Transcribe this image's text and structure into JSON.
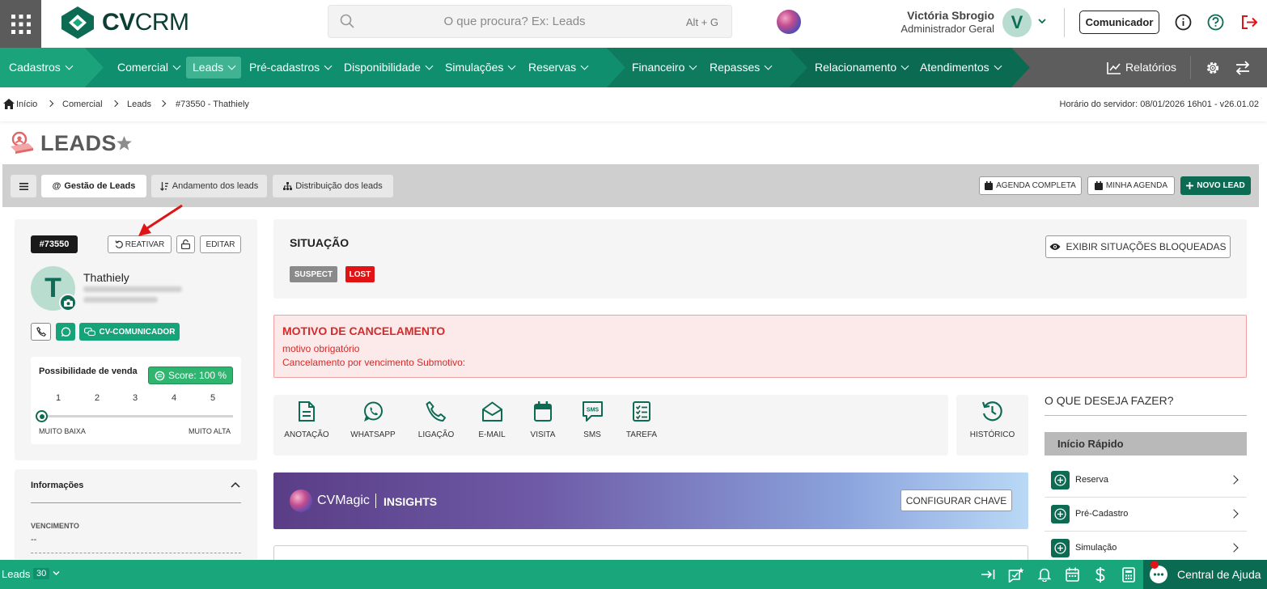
{
  "app": {
    "logo_bold": "CV",
    "logo_light": "CRM"
  },
  "search": {
    "placeholder": "O que procura? Ex: Leads",
    "shortcut": "Alt + G"
  },
  "user": {
    "name": "Victória Sbrogio",
    "role": "Administrador Geral",
    "initial": "V"
  },
  "header": {
    "communicator_label": "Comunicador"
  },
  "nav": {
    "items": [
      {
        "label": "Cadastros"
      },
      {
        "label": "Comercial"
      },
      {
        "label": "Leads"
      },
      {
        "label": "Pré-cadastros"
      },
      {
        "label": "Disponibilidade"
      },
      {
        "label": "Simulações"
      },
      {
        "label": "Reservas"
      },
      {
        "label": "Financeiro"
      },
      {
        "label": "Repasses"
      },
      {
        "label": "Relacionamento"
      },
      {
        "label": "Atendimentos"
      }
    ],
    "reports_label": "Relatórios",
    "colors": {
      "seg1": "#17a57c",
      "seg2": "#0f8f6d",
      "seg3": "#0e7a5e",
      "seg4": "#0b6a52",
      "gray": "#5d5d5d"
    }
  },
  "breadcrumb": {
    "items": [
      "Início",
      "Comercial",
      "Leads",
      "#73550 - Thathiely"
    ],
    "server_time": "Horário do servidor: 08/01/2026 16h01 - v26.01.02"
  },
  "page": {
    "title": "LEADS"
  },
  "tabs": [
    {
      "label": "Gestão de Leads"
    },
    {
      "label": "Andamento dos leads"
    },
    {
      "label": "Distribuição dos leads"
    }
  ],
  "toolbar_right": {
    "agenda_completa": "AGENDA COMPLETA",
    "minha_agenda": "MINHA AGENDA",
    "novo_lead": "NOVO LEAD"
  },
  "lead": {
    "id": "#73550",
    "reactivate_label": "REATIVAR",
    "edit_label": "EDITAR",
    "initial": "T",
    "name": "Thathiely",
    "communicator_label": "CV-COMUNICADOR"
  },
  "score": {
    "title": "Possibilidade de venda",
    "badge": "Score: 100 %",
    "scale": [
      "1",
      "2",
      "3",
      "4",
      "5"
    ],
    "low_label": "MUITO BAIXA",
    "high_label": "MUITO ALTA",
    "selected_level": 0
  },
  "info": {
    "title": "Informações",
    "field_label": "VENCIMENTO",
    "field_value": "--"
  },
  "situation": {
    "title": "SITUAÇÃO",
    "tags": [
      {
        "label": "SUSPECT",
        "color": "#8a8a8a"
      },
      {
        "label": "LOST",
        "color": "#e01414"
      }
    ],
    "show_blocked_label": "EXIBIR SITUAÇÕES BLOQUEADAS"
  },
  "cancellation": {
    "title": "MOTIVO DE CANCELAMENTO",
    "line1": "motivo obrigatório",
    "line2": "Cancelamento por vencimento Submotivo:"
  },
  "actions": [
    {
      "label": "ANOTAÇÃO",
      "icon": "note-icon"
    },
    {
      "label": "WHATSAPP",
      "icon": "whatsapp-icon"
    },
    {
      "label": "LIGAÇÃO",
      "icon": "phone-icon"
    },
    {
      "label": "E-MAIL",
      "icon": "email-icon"
    },
    {
      "label": "VISITA",
      "icon": "calendar-icon"
    },
    {
      "label": "SMS",
      "icon": "sms-icon"
    },
    {
      "label": "TAREFA",
      "icon": "task-icon"
    }
  ],
  "history_label": "HISTÓRICO",
  "quick": {
    "title": "O QUE DESEJA FAZER?",
    "section": "Início Rápido",
    "items": [
      {
        "label": "Reserva"
      },
      {
        "label": "Pré-Cadastro"
      },
      {
        "label": "Simulação"
      }
    ]
  },
  "cvmagic": {
    "brand": "CVMagic",
    "section": "INSIGHTS",
    "configure_label": "CONFIGURAR CHAVE"
  },
  "footer": {
    "leads_label": "Leads",
    "leads_count": "30",
    "help_label": "Central de Ajuda"
  },
  "colors": {
    "primary": "#0d6b53",
    "accent": "#18a67a",
    "danger": "#e01414"
  }
}
